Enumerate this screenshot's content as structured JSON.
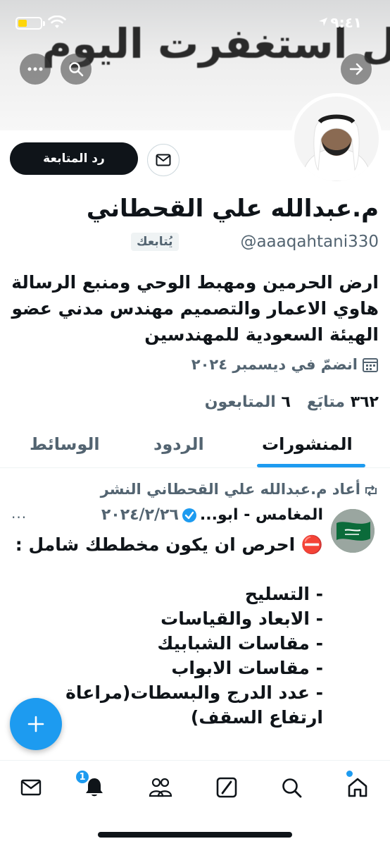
{
  "status_bar": {
    "time": "٩:٤١"
  },
  "banner": {
    "text": "ل استغفرت اليوم"
  },
  "profile": {
    "unfollow_label": "رد المتابعة",
    "name": "م.عبدالله علي القحطاني",
    "handle": "@aaaqahtani330",
    "follows_you": "يُتابعك",
    "bio": "ارض الحرمين ومهبط الوحي ومنبع الرسالة هاوي الاعمار والتصميم مهندس مدني عضو الهيئة السعودية للمهندسين",
    "joined": "انضمّ في ديسمبر ٢٠٢٤",
    "following_count": "٣٦٢",
    "following_label": "متابَع",
    "followers_count": "٦",
    "followers_label": "المتابعون"
  },
  "tabs": {
    "posts": "المنشورات",
    "replies": "الردود",
    "media": "الوسائط"
  },
  "post": {
    "repost_text": "أعاد م.عبدالله علي القحطاني النشر",
    "author": "المغامس - ابو...",
    "date": "٢٠٢٤/٢/٢٦",
    "more": "···",
    "body": "⛔ احرص ان يكون مخططك شامل :\n\n- التسليح\n- الابعاد والقياسات\n- مقاسات الشبابيك\n- مقاسات الابواب\n- عدد الدرج والبسطات(مراعاة ارتفاع السقف)"
  },
  "bottom_nav": {
    "notifications_badge": "1"
  },
  "colors": {
    "accent": "#1d9bf0",
    "text": "#0f1419",
    "muted": "#536471"
  }
}
